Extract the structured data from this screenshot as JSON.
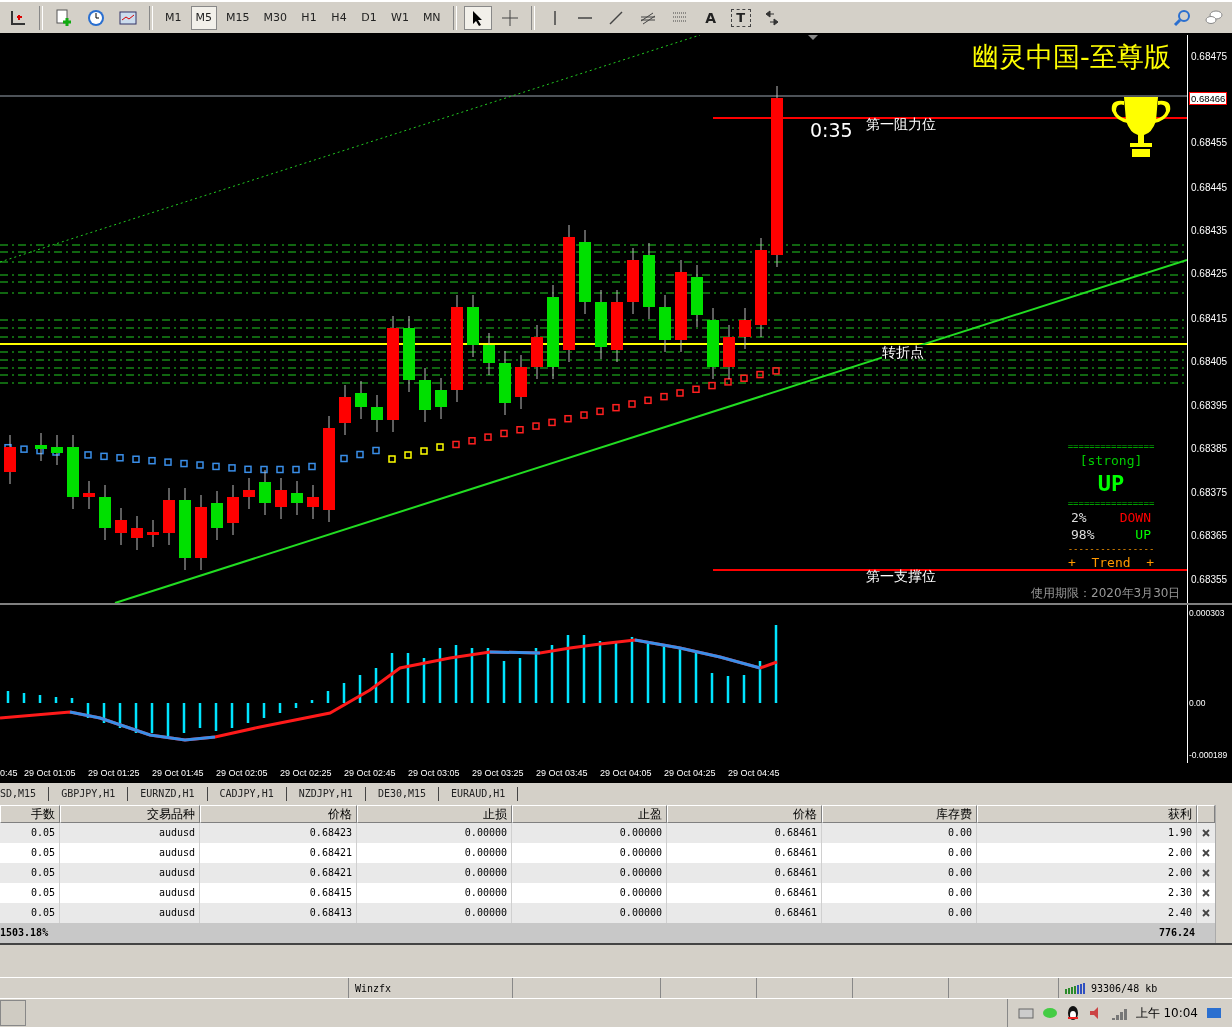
{
  "toolbar": {
    "timeframes": [
      {
        "label": "M1",
        "selected": false
      },
      {
        "label": "M5",
        "selected": true
      },
      {
        "label": "M15",
        "selected": false
      },
      {
        "label": "M30",
        "selected": false
      },
      {
        "label": "H1",
        "selected": false
      },
      {
        "label": "H4",
        "selected": false
      },
      {
        "label": "D1",
        "selected": false
      },
      {
        "label": "W1",
        "selected": false
      },
      {
        "label": "MN",
        "selected": false
      }
    ],
    "tool_glyphs": [
      "A",
      "T"
    ]
  },
  "chart": {
    "title": "幽灵中国-至尊版",
    "countdown": "0:35",
    "resistance_label": "第一阻力位",
    "pivot_label": "转折点",
    "support_label": "第一支撑位",
    "price_tag": "0.68466",
    "price_axis": [
      "0.68475",
      "0.68455",
      "0.68445",
      "0.68435",
      "0.68425",
      "0.68415",
      "0.68405",
      "0.68395",
      "0.68385",
      "0.68375",
      "0.68365",
      "0.68355"
    ],
    "trend_panel": {
      "rule_top": "================",
      "strength": "[strong]",
      "direction": "UP",
      "rule_mid": "================",
      "down_pct": "2%",
      "down_label": "DOWN",
      "up_pct": "98%",
      "up_label": "UP",
      "rule_bottom": "----------------",
      "trend": "+  Trend  +"
    },
    "license": "使用期限：2020年3月30日"
  },
  "indicator": {
    "axis": [
      "0.000303",
      "0.00",
      "-0.000189"
    ]
  },
  "time_axis": [
    "0:45",
    "29 Oct 01:05",
    "29 Oct 01:25",
    "29 Oct 01:45",
    "29 Oct 02:05",
    "29 Oct 02:25",
    "29 Oct 02:45",
    "29 Oct 03:05",
    "29 Oct 03:25",
    "29 Oct 03:45",
    "29 Oct 04:05",
    "29 Oct 04:25",
    "29 Oct 04:45"
  ],
  "chart_tabs": [
    "SD,M15",
    "GBPJPY,H1",
    "EURNZD,H1",
    "CADJPY,H1",
    "NZDJPY,H1",
    "DE30,M15",
    "EURAUD,H1"
  ],
  "trades": {
    "columns": [
      "手数",
      "交易品种",
      "价格",
      "止损",
      "止盈",
      "价格",
      "库存费",
      "获利"
    ],
    "rows": [
      [
        "0.05",
        "audusd",
        "0.68423",
        "0.00000",
        "0.00000",
        "0.68461",
        "0.00",
        "1.90"
      ],
      [
        "0.05",
        "audusd",
        "0.68421",
        "0.00000",
        "0.00000",
        "0.68461",
        "0.00",
        "2.00"
      ],
      [
        "0.05",
        "audusd",
        "0.68421",
        "0.00000",
        "0.00000",
        "0.68461",
        "0.00",
        "2.00"
      ],
      [
        "0.05",
        "audusd",
        "0.68415",
        "0.00000",
        "0.00000",
        "0.68461",
        "0.00",
        "2.30"
      ],
      [
        "0.05",
        "audusd",
        "0.68413",
        "0.00000",
        "0.00000",
        "0.68461",
        "0.00",
        "2.40"
      ]
    ],
    "total": {
      "balance": "1503.18%",
      "profit": "776.24"
    }
  },
  "status_bar": {
    "server": "Winzfx",
    "traffic": "93306/48 kb"
  },
  "taskbar": {
    "clock": "上午 10:04"
  }
}
